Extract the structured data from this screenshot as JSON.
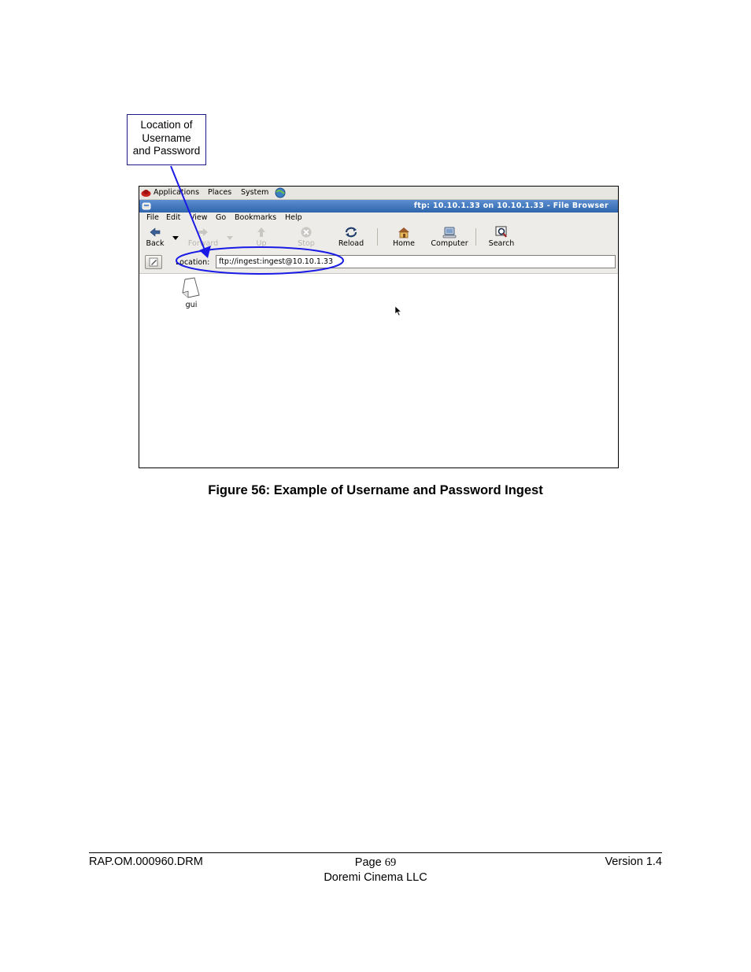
{
  "callout": {
    "line1": "Location of",
    "line2": "Username",
    "line3": "and Password"
  },
  "panel": {
    "applications": "Applications",
    "places": "Places",
    "system": "System"
  },
  "window": {
    "title": "ftp: 10.10.1.33 on 10.10.1.33 - File Browser"
  },
  "menu": {
    "file": "File",
    "edit": "Edit",
    "view": "View",
    "go": "Go",
    "bookmarks": "Bookmarks",
    "help": "Help"
  },
  "toolbar": {
    "back": "Back",
    "forward": "Forward",
    "up": "Up",
    "stop": "Stop",
    "reload": "Reload",
    "home": "Home",
    "computer": "Computer",
    "search": "Search"
  },
  "location": {
    "label": "Location:",
    "value": "ftp://ingest:ingest@10.10.1.33"
  },
  "files": [
    {
      "name": "gui"
    }
  ],
  "annotation": {
    "color": "#1a1ae6"
  },
  "caption": "Figure 56: Example of Username and Password Ingest",
  "footer": {
    "doc_id": "RAP.OM.000960.DRM",
    "page_label": "Page",
    "page_number": "69",
    "company": "Doremi Cinema LLC",
    "version": "Version 1.4"
  }
}
